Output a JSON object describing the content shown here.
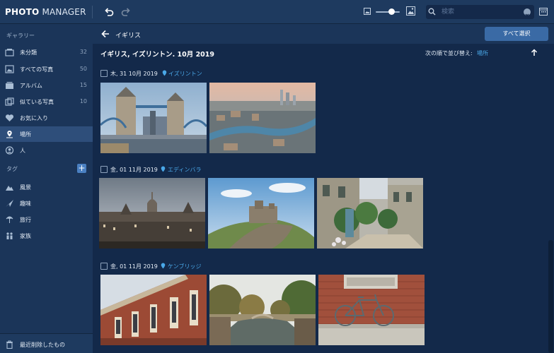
{
  "app": {
    "logo_bold": "PHOTO",
    "logo_light": "MANAGER"
  },
  "toolbar": {
    "search_placeholder": "検索"
  },
  "sidebar": {
    "gallery_label": "ギャラリー",
    "items": [
      {
        "label": "未分類",
        "count": "32",
        "icon": "uncategorized-icon"
      },
      {
        "label": "すべての写真",
        "count": "50",
        "icon": "photos-icon"
      },
      {
        "label": "アルバム",
        "count": "15",
        "icon": "album-icon"
      },
      {
        "label": "似ている写真",
        "count": "10",
        "icon": "similar-icon"
      },
      {
        "label": "お気に入り",
        "count": "",
        "icon": "heart-icon"
      },
      {
        "label": "場所",
        "count": "",
        "icon": "location-icon"
      },
      {
        "label": "人",
        "count": "",
        "icon": "person-icon"
      }
    ],
    "tags_label": "タグ",
    "tags": [
      {
        "label": "風景",
        "icon": "landscape-icon"
      },
      {
        "label": "趣味",
        "icon": "hobby-icon"
      },
      {
        "label": "旅行",
        "icon": "travel-icon"
      },
      {
        "label": "家族",
        "icon": "family-icon"
      }
    ],
    "trash_label": "最近削除したもの"
  },
  "main": {
    "breadcrumb": "イギリス",
    "select_all": "すべて選択",
    "location_title": "イギリス, イズリントン. 10月 2019",
    "sort_label": "次の順で並び替え:",
    "sort_value": "場所",
    "groups": [
      {
        "date": "木, 31 10月 2019",
        "place": "イズリントン"
      },
      {
        "date": "金, 01 11月 2019",
        "place": "エディンバラ"
      },
      {
        "date": "金, 01 11月 2019",
        "place": "ケンブリッジ"
      }
    ]
  },
  "colors": {
    "accent": "#4aa8e8",
    "button": "#3a6aa5",
    "active_row": "#2e4e7a",
    "background": "#13294a"
  }
}
